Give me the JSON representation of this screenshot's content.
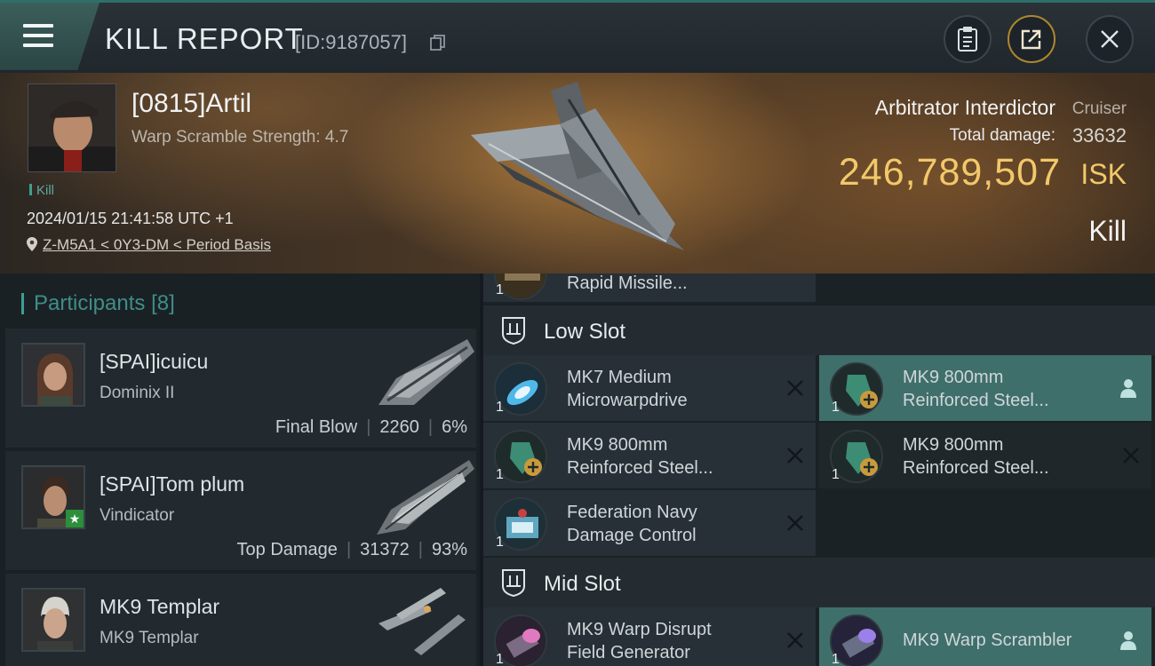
{
  "header": {
    "title": "KILL REPORT",
    "report_id": "[ID:9187057]"
  },
  "hero": {
    "pilot_name": "[0815]Artil",
    "scramble": "Warp Scramble Strength: 4.7",
    "kill_tag": "Kill",
    "timestamp": "2024/01/15 21:41:58 UTC +1",
    "location": "Z-M5A1 < 0Y3-DM < Period Basis",
    "ship_name": "Arbitrator Interdictor",
    "ship_class": "Cruiser",
    "damage_label": "Total damage:",
    "damage_value": "33632",
    "isk_value": "246,789,507",
    "isk_unit": "ISK",
    "result": "Kill"
  },
  "participants": {
    "title": "Participants",
    "count": "[8]",
    "rows": [
      {
        "name": "[SPAI]icuicu",
        "ship": "Dominix II",
        "label": "Final Blow",
        "damage": "2260",
        "percent": "6%"
      },
      {
        "name": "[SPAI]Tom plum",
        "ship": "Vindicator",
        "label": "Top Damage",
        "damage": "31372",
        "percent": "93%"
      },
      {
        "name": "MK9 Templar",
        "ship": "MK9 Templar"
      }
    ]
  },
  "fitting": {
    "partial_top": {
      "qty": "1",
      "name": "Rapid Missile..."
    },
    "low_slot": {
      "title": "Low Slot",
      "modules": [
        {
          "qty": "1",
          "line1": "MK7 Medium",
          "line2": "Microwarpdrive"
        },
        {
          "qty": "1",
          "line1": "MK9 800mm",
          "line2": "Reinforced Steel..."
        },
        {
          "qty": "1",
          "line1": "MK9 800mm",
          "line2": "Reinforced Steel..."
        },
        {
          "qty": "1",
          "line1": "MK9 800mm",
          "line2": "Reinforced Steel..."
        },
        {
          "qty": "1",
          "line1": "Federation Navy",
          "line2": "Damage Control"
        }
      ]
    },
    "mid_slot": {
      "title": "Mid Slot",
      "modules": [
        {
          "qty": "1",
          "line1": "MK9 Warp Disrupt",
          "line2": "Field Generator"
        },
        {
          "qty": "1",
          "line1": "MK9 Warp Scrambler"
        }
      ]
    }
  },
  "colors": {
    "accent": "#3f9e95",
    "isk": "#f2c86a",
    "highlight": "#3f6f6b"
  }
}
